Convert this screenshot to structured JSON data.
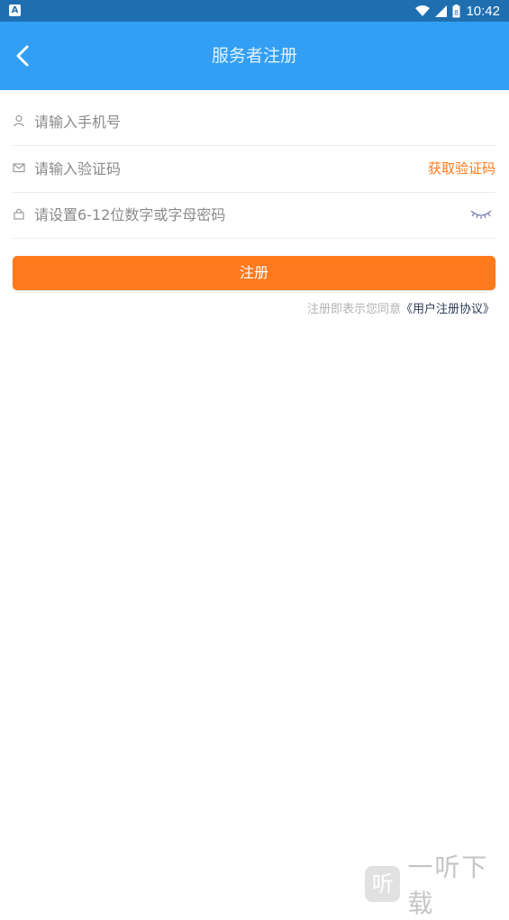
{
  "status_bar": {
    "app_icon_letter": "A",
    "time": "10:42",
    "battery_level": "8"
  },
  "appbar": {
    "title": "服务者注册",
    "back_icon": "chevron-left-icon"
  },
  "form": {
    "phone": {
      "placeholder": "请输入手机号",
      "icon": "user-icon"
    },
    "code": {
      "placeholder": "请输入验证码",
      "icon": "mail-icon",
      "get_code_label": "获取验证码"
    },
    "password": {
      "placeholder": "请设置6-12位数字或字母密码",
      "icon": "lock-icon",
      "toggle_icon": "eye-closed-icon"
    }
  },
  "register": {
    "label": "注册"
  },
  "agreement": {
    "prefix": "注册即表示您同意",
    "link": "《用户注册协议》"
  },
  "watermark": {
    "logo_char": "听",
    "text": "一听下载"
  },
  "colors": {
    "status_bar": "#1f6fb0",
    "appbar": "#329ff4",
    "accent_orange": "#ff7a1d",
    "link_dark": "#2e3d57"
  }
}
